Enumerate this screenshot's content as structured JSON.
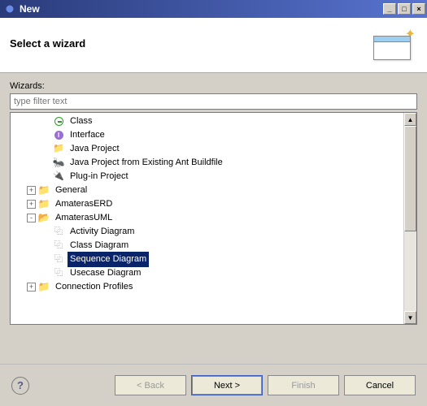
{
  "window": {
    "title": "New"
  },
  "header": {
    "title": "Select a wizard"
  },
  "wizards_label": "Wizards:",
  "filter_placeholder": "type filter text",
  "tree": {
    "items": [
      {
        "label": "Class",
        "level": 1,
        "expander": null,
        "icon": "class"
      },
      {
        "label": "Interface",
        "level": 1,
        "expander": null,
        "icon": "interface"
      },
      {
        "label": "Java Project",
        "level": 1,
        "expander": null,
        "icon": "java-project"
      },
      {
        "label": "Java Project from Existing Ant Buildfile",
        "level": 1,
        "expander": null,
        "icon": "ant"
      },
      {
        "label": "Plug-in Project",
        "level": 1,
        "expander": null,
        "icon": "plugin"
      },
      {
        "label": "General",
        "level": 0,
        "expander": "+",
        "icon": "folder-closed"
      },
      {
        "label": "AmaterasERD",
        "level": 0,
        "expander": "+",
        "icon": "folder-closed"
      },
      {
        "label": "AmaterasUML",
        "level": 0,
        "expander": "-",
        "icon": "folder-open"
      },
      {
        "label": "Activity Diagram",
        "level": 1,
        "expander": null,
        "icon": "diagram"
      },
      {
        "label": "Class Diagram",
        "level": 1,
        "expander": null,
        "icon": "diagram"
      },
      {
        "label": "Sequence Diagram",
        "level": 1,
        "expander": null,
        "icon": "diagram",
        "selected": true
      },
      {
        "label": "Usecase Diagram",
        "level": 1,
        "expander": null,
        "icon": "diagram"
      },
      {
        "label": "Connection Profiles",
        "level": 0,
        "expander": "+",
        "icon": "folder-closed"
      }
    ]
  },
  "buttons": {
    "back": "< Back",
    "next": "Next >",
    "finish": "Finish",
    "cancel": "Cancel"
  }
}
